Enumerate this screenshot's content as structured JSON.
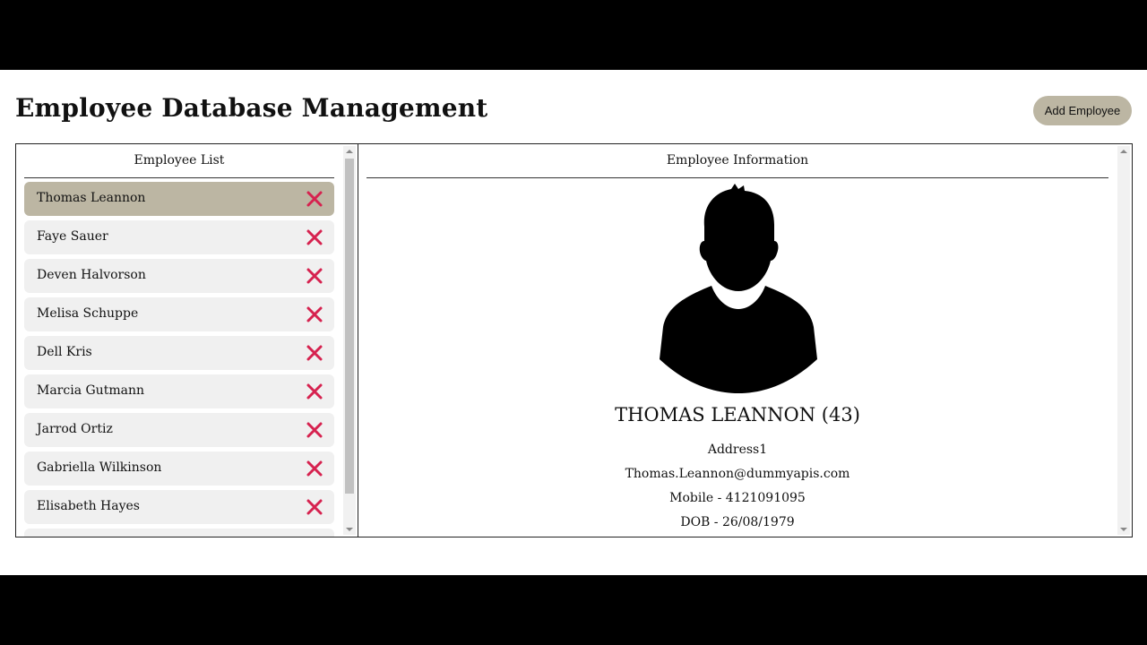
{
  "header": {
    "title": "Employee Database Management",
    "add_button_label": "Add Employee"
  },
  "employee_list": {
    "heading": "Employee List",
    "selected_index": 0,
    "items": [
      {
        "name": "Thomas Leannon"
      },
      {
        "name": "Faye Sauer"
      },
      {
        "name": "Deven Halvorson"
      },
      {
        "name": "Melisa Schuppe"
      },
      {
        "name": "Dell Kris"
      },
      {
        "name": "Marcia Gutmann"
      },
      {
        "name": "Jarrod Ortiz"
      },
      {
        "name": "Gabriella Wilkinson"
      },
      {
        "name": "Elisabeth Hayes"
      }
    ],
    "delete_icon": "close-x-icon"
  },
  "employee_info": {
    "heading": "Employee Information",
    "avatar_icon": "person-silhouette-icon",
    "name_age": "THOMAS LEANNON (43)",
    "address": "Address1",
    "email": "Thomas.Leannon@dummyapis.com",
    "mobile": "Mobile - 4121091095",
    "dob": "DOB - 26/08/1979"
  },
  "colors": {
    "accent": "#bcb6a3",
    "list_item_bg": "#f0f0f0",
    "delete_icon": "#d6224f"
  }
}
